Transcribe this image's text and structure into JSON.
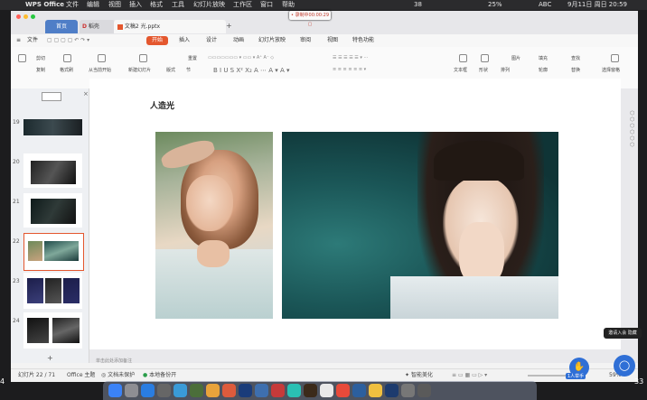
{
  "menubar": {
    "app_name": "WPS Office",
    "items": [
      "文件",
      "编辑",
      "视图",
      "插入",
      "格式",
      "工具",
      "幻灯片放映",
      "工作区",
      "窗口",
      "帮助"
    ],
    "right": {
      "badge": "38",
      "battery": "25%",
      "input": "ABC",
      "datetime": "9月11日 周日 20:59"
    }
  },
  "recording": {
    "label": "• 录制中00:00:29 ▢"
  },
  "tabs": {
    "home": "首页",
    "draft": "稻壳",
    "doc": "文稿2 光.pptx",
    "add": "+"
  },
  "ribbon_tabs": {
    "file": "文件",
    "items": [
      "开始",
      "插入",
      "设计",
      "动画",
      "幻灯片放映",
      "审阅",
      "视图",
      "特色功能"
    ]
  },
  "ribbon": {
    "cut": "剪切",
    "copy": "复制",
    "format_painter": "格式刷",
    "play_from_current": "从当前开始",
    "new_slide": "新建幻灯片",
    "layout": "版式",
    "section": "节",
    "reset": "重置",
    "textbox": "文本框",
    "shape": "形状",
    "arrange": "排列",
    "picture": "图片",
    "fill": "填充",
    "find": "查找",
    "outline": "轮廓",
    "replace": "替换",
    "select_pane": "选择窗格"
  },
  "slides": [
    {
      "num": "19"
    },
    {
      "num": "20"
    },
    {
      "num": "21"
    },
    {
      "num": "22"
    },
    {
      "num": "23"
    },
    {
      "num": "24"
    }
  ],
  "slide": {
    "title": "人造光",
    "note_placeholder": "单击此处添加备注"
  },
  "sidebar": {
    "add": "+"
  },
  "status": {
    "slide_counter": "幻灯片 22 / 71",
    "theme": "Office 主题",
    "doc_unprotected": "文档未保护",
    "local_backup": "本地备份开",
    "smart_beautify": "智能美化",
    "left_edge": "4",
    "right_edge": "33",
    "zoom": "59%"
  },
  "overlay": {
    "hand_label": "1人举手",
    "chat_label": "邀请入会",
    "tooltip": "邀请入会 隐藏"
  },
  "colors": {
    "accent": "#e4572e",
    "tab_blue": "#3f6fb5",
    "overlay_blue": "#2f6fd6"
  }
}
